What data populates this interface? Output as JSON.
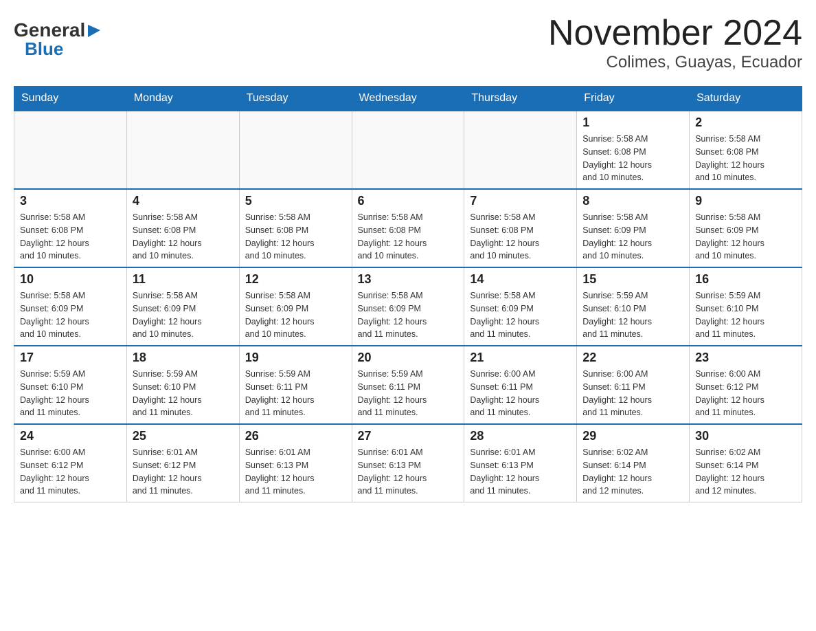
{
  "header": {
    "logo_general": "General",
    "logo_blue": "Blue",
    "title": "November 2024",
    "subtitle": "Colimes, Guayas, Ecuador"
  },
  "weekdays": [
    "Sunday",
    "Monday",
    "Tuesday",
    "Wednesday",
    "Thursday",
    "Friday",
    "Saturday"
  ],
  "weeks": [
    [
      {
        "day": "",
        "info": ""
      },
      {
        "day": "",
        "info": ""
      },
      {
        "day": "",
        "info": ""
      },
      {
        "day": "",
        "info": ""
      },
      {
        "day": "",
        "info": ""
      },
      {
        "day": "1",
        "info": "Sunrise: 5:58 AM\nSunset: 6:08 PM\nDaylight: 12 hours\nand 10 minutes."
      },
      {
        "day": "2",
        "info": "Sunrise: 5:58 AM\nSunset: 6:08 PM\nDaylight: 12 hours\nand 10 minutes."
      }
    ],
    [
      {
        "day": "3",
        "info": "Sunrise: 5:58 AM\nSunset: 6:08 PM\nDaylight: 12 hours\nand 10 minutes."
      },
      {
        "day": "4",
        "info": "Sunrise: 5:58 AM\nSunset: 6:08 PM\nDaylight: 12 hours\nand 10 minutes."
      },
      {
        "day": "5",
        "info": "Sunrise: 5:58 AM\nSunset: 6:08 PM\nDaylight: 12 hours\nand 10 minutes."
      },
      {
        "day": "6",
        "info": "Sunrise: 5:58 AM\nSunset: 6:08 PM\nDaylight: 12 hours\nand 10 minutes."
      },
      {
        "day": "7",
        "info": "Sunrise: 5:58 AM\nSunset: 6:08 PM\nDaylight: 12 hours\nand 10 minutes."
      },
      {
        "day": "8",
        "info": "Sunrise: 5:58 AM\nSunset: 6:09 PM\nDaylight: 12 hours\nand 10 minutes."
      },
      {
        "day": "9",
        "info": "Sunrise: 5:58 AM\nSunset: 6:09 PM\nDaylight: 12 hours\nand 10 minutes."
      }
    ],
    [
      {
        "day": "10",
        "info": "Sunrise: 5:58 AM\nSunset: 6:09 PM\nDaylight: 12 hours\nand 10 minutes."
      },
      {
        "day": "11",
        "info": "Sunrise: 5:58 AM\nSunset: 6:09 PM\nDaylight: 12 hours\nand 10 minutes."
      },
      {
        "day": "12",
        "info": "Sunrise: 5:58 AM\nSunset: 6:09 PM\nDaylight: 12 hours\nand 10 minutes."
      },
      {
        "day": "13",
        "info": "Sunrise: 5:58 AM\nSunset: 6:09 PM\nDaylight: 12 hours\nand 11 minutes."
      },
      {
        "day": "14",
        "info": "Sunrise: 5:58 AM\nSunset: 6:09 PM\nDaylight: 12 hours\nand 11 minutes."
      },
      {
        "day": "15",
        "info": "Sunrise: 5:59 AM\nSunset: 6:10 PM\nDaylight: 12 hours\nand 11 minutes."
      },
      {
        "day": "16",
        "info": "Sunrise: 5:59 AM\nSunset: 6:10 PM\nDaylight: 12 hours\nand 11 minutes."
      }
    ],
    [
      {
        "day": "17",
        "info": "Sunrise: 5:59 AM\nSunset: 6:10 PM\nDaylight: 12 hours\nand 11 minutes."
      },
      {
        "day": "18",
        "info": "Sunrise: 5:59 AM\nSunset: 6:10 PM\nDaylight: 12 hours\nand 11 minutes."
      },
      {
        "day": "19",
        "info": "Sunrise: 5:59 AM\nSunset: 6:11 PM\nDaylight: 12 hours\nand 11 minutes."
      },
      {
        "day": "20",
        "info": "Sunrise: 5:59 AM\nSunset: 6:11 PM\nDaylight: 12 hours\nand 11 minutes."
      },
      {
        "day": "21",
        "info": "Sunrise: 6:00 AM\nSunset: 6:11 PM\nDaylight: 12 hours\nand 11 minutes."
      },
      {
        "day": "22",
        "info": "Sunrise: 6:00 AM\nSunset: 6:11 PM\nDaylight: 12 hours\nand 11 minutes."
      },
      {
        "day": "23",
        "info": "Sunrise: 6:00 AM\nSunset: 6:12 PM\nDaylight: 12 hours\nand 11 minutes."
      }
    ],
    [
      {
        "day": "24",
        "info": "Sunrise: 6:00 AM\nSunset: 6:12 PM\nDaylight: 12 hours\nand 11 minutes."
      },
      {
        "day": "25",
        "info": "Sunrise: 6:01 AM\nSunset: 6:12 PM\nDaylight: 12 hours\nand 11 minutes."
      },
      {
        "day": "26",
        "info": "Sunrise: 6:01 AM\nSunset: 6:13 PM\nDaylight: 12 hours\nand 11 minutes."
      },
      {
        "day": "27",
        "info": "Sunrise: 6:01 AM\nSunset: 6:13 PM\nDaylight: 12 hours\nand 11 minutes."
      },
      {
        "day": "28",
        "info": "Sunrise: 6:01 AM\nSunset: 6:13 PM\nDaylight: 12 hours\nand 11 minutes."
      },
      {
        "day": "29",
        "info": "Sunrise: 6:02 AM\nSunset: 6:14 PM\nDaylight: 12 hours\nand 12 minutes."
      },
      {
        "day": "30",
        "info": "Sunrise: 6:02 AM\nSunset: 6:14 PM\nDaylight: 12 hours\nand 12 minutes."
      }
    ]
  ]
}
